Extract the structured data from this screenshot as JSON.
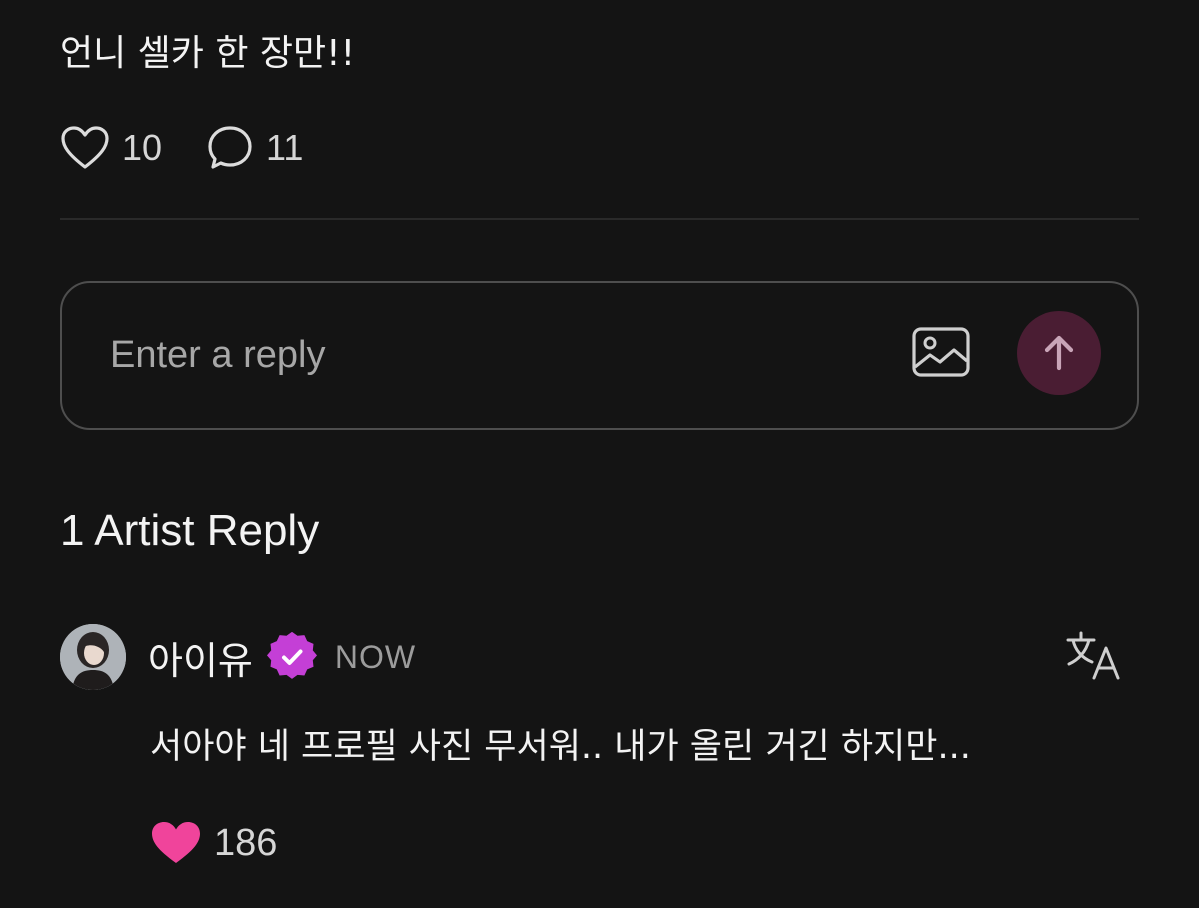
{
  "post": {
    "text": "언니 셀카 한 장만!!",
    "like_count": "10",
    "comment_count": "11"
  },
  "reply_box": {
    "placeholder": "Enter a reply"
  },
  "artist_replies": {
    "title": "1 Artist Reply",
    "items": [
      {
        "author": "아이유",
        "timestamp": "NOW",
        "text": "서아야 네 프로필 사진 무서워.. 내가 올린 거긴 하지만...",
        "like_count": "186"
      }
    ]
  },
  "icons": {
    "like": "heart-outline-icon",
    "comment": "speech-bubble-icon",
    "image": "image-icon",
    "send": "arrow-up-icon",
    "verified": "verified-badge-icon",
    "translate": "translate-icon",
    "liked": "heart-filled-icon"
  },
  "colors": {
    "background": "#141414",
    "accent": "#d63ea0",
    "send_button": "#4a1d33",
    "liked_heart": "#f0449b",
    "verified_badge": "#c43fd6"
  }
}
